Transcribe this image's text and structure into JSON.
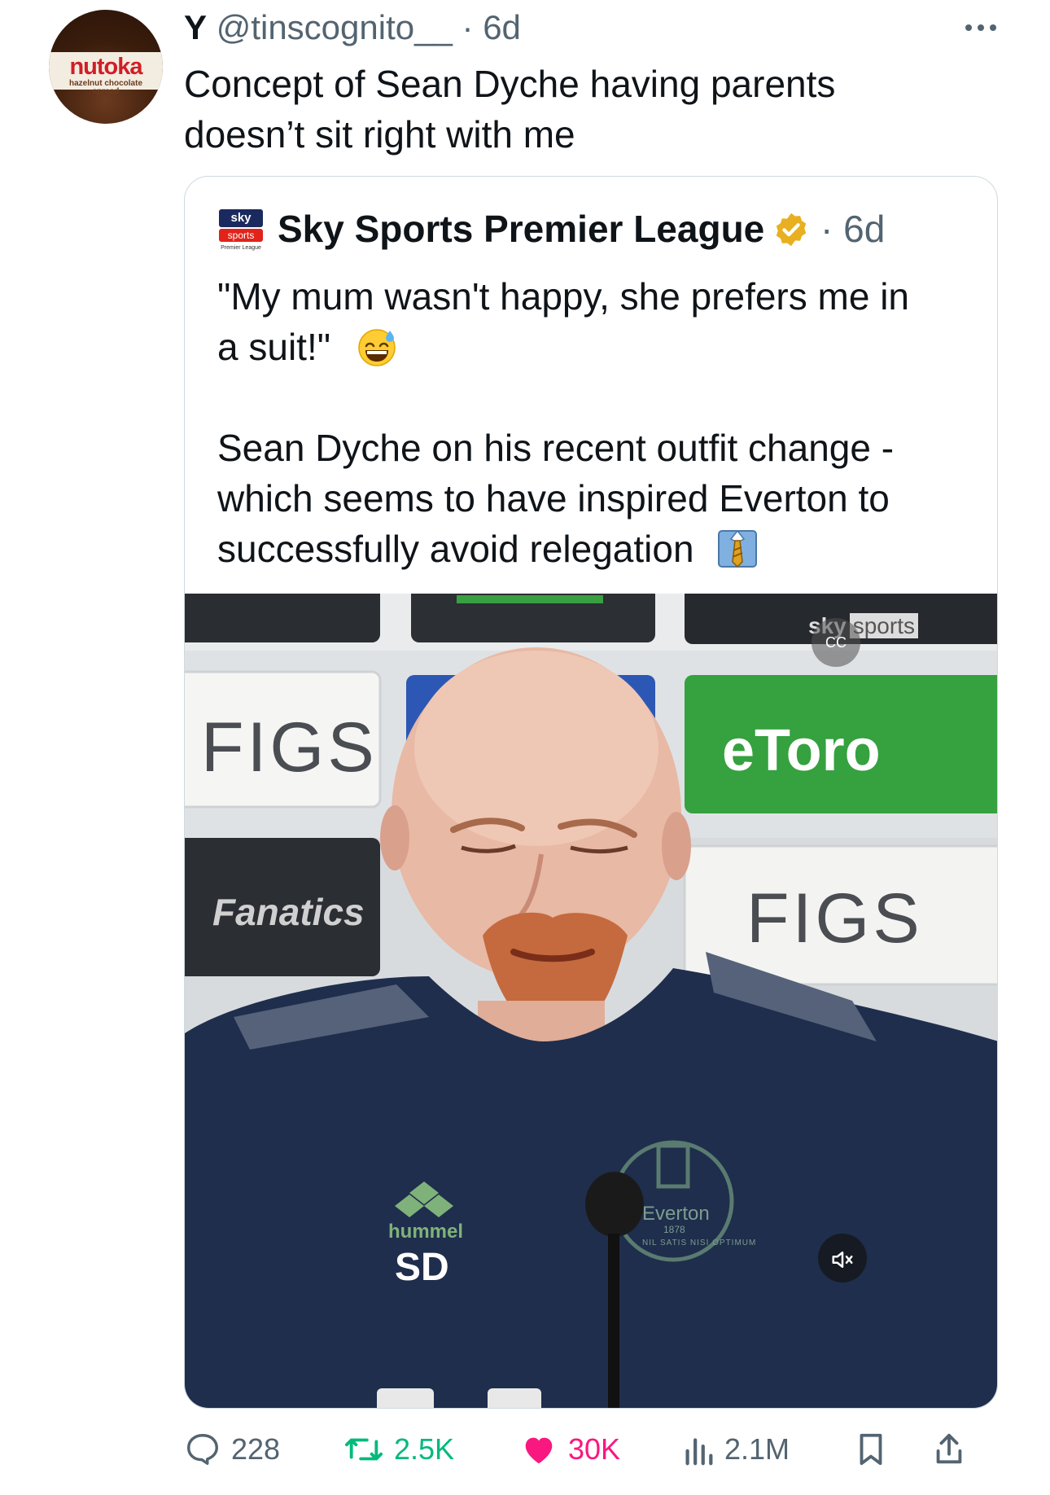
{
  "tweet": {
    "avatar_brand": "nutoka",
    "avatar_sub": "hazelnut chocolate spread",
    "display_name": "Y",
    "handle": "@tinscognito__",
    "separator": "·",
    "time": "6d",
    "text_line1": "Concept of Sean Dyche having parents",
    "text_line2": "doesn’t sit right with me",
    "more_icon": "more-dots-icon"
  },
  "quote": {
    "logo_sky": "sky",
    "logo_sports": "sports",
    "logo_pl": "Premier League",
    "name": "Sky Sports Premier League",
    "verified_icon": "verified-badge-icon",
    "separator": "·",
    "time": "6d",
    "text_line1": "\"My mum wasn't happy, she prefers me in",
    "text_line2": "a suit!\"",
    "text_line3": "Sean Dyche on his recent outfit change -",
    "text_line4": "which seems to have inspired Everton to",
    "text_line5": "successfully avoid relegation",
    "emoji1": "sweat-smile-emoji",
    "emoji2": "necktie-emoji"
  },
  "media": {
    "sponsor_figs": "FIGS",
    "sponsor_etoro": "eToro",
    "sponsor_fanatics": "Fanatics",
    "watermark_sky": "sky",
    "watermark_sports": "sports",
    "cc_label": "CC",
    "kit_brand": "hummel",
    "kit_initials": "SD",
    "crest_name": "Everton",
    "crest_year": "1878",
    "crest_motto": "NIL SATIS NISI OPTIMUM",
    "mute_icon": "speaker-muted-icon"
  },
  "actions": {
    "replies": "228",
    "retweets": "2.5K",
    "likes": "30K",
    "views": "2.1M",
    "colors": {
      "muted": "#536471",
      "like": "#f91880",
      "retweet": "#00ba7c"
    }
  }
}
